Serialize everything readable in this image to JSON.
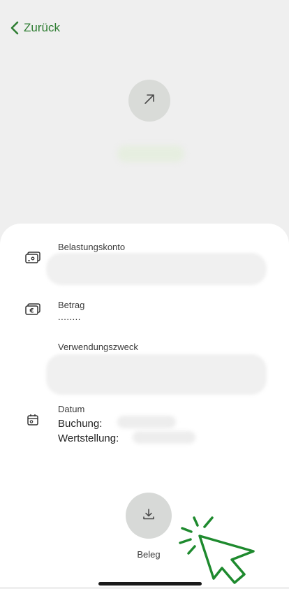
{
  "nav": {
    "back_label": "Zurück"
  },
  "icons": {
    "back": "chevron-left-icon",
    "direction": "arrow-up-right-icon",
    "account": "card-wallet-icon",
    "amount": "euro-card-icon",
    "date": "calendar-icon",
    "download": "download-icon",
    "cursor": "click-cursor-icon"
  },
  "details": {
    "account_label": "Belastungskonto",
    "amount_label": "Betrag",
    "amount_value": "........",
    "purpose_label": "Verwendungszweck",
    "date_label": "Datum",
    "booking_label": "Buchung:",
    "value_date_label": "Wertstellung:"
  },
  "actions": {
    "receipt_label": "Beleg"
  },
  "colors": {
    "accent_green": "#2e7d32",
    "header_bg": "#efefef",
    "circle_gray": "#d9dbd8"
  }
}
